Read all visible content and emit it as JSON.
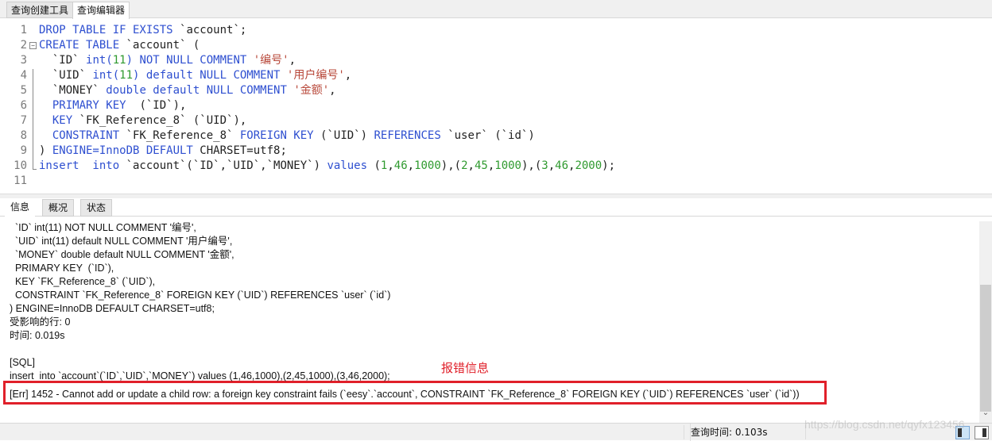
{
  "top_tabs": [
    {
      "label": "查询创建工具",
      "active": false
    },
    {
      "label": "查询编辑器",
      "active": true
    }
  ],
  "editor": {
    "lines": [
      {
        "n": "1",
        "tokens": [
          [
            "kw",
            "DROP TABLE IF EXISTS "
          ],
          [
            "pl",
            "`account`;"
          ]
        ]
      },
      {
        "n": "2",
        "fold": "−",
        "tokens": [
          [
            "kw",
            "CREATE TABLE "
          ],
          [
            "pl",
            "`account` ("
          ]
        ]
      },
      {
        "n": "3",
        "tokens": [
          [
            "pl",
            "  `ID` "
          ],
          [
            "kw",
            "int("
          ],
          [
            "num",
            "11"
          ],
          [
            "kw",
            ") NOT NULL COMMENT "
          ],
          [
            "str",
            "'编号'"
          ],
          [
            "pl",
            ","
          ]
        ]
      },
      {
        "n": "4",
        "tokens": [
          [
            "pl",
            "  `UID` "
          ],
          [
            "kw",
            "int("
          ],
          [
            "num",
            "11"
          ],
          [
            "kw",
            ") default NULL COMMENT "
          ],
          [
            "str",
            "'用户编号'"
          ],
          [
            "pl",
            ","
          ]
        ]
      },
      {
        "n": "5",
        "tokens": [
          [
            "pl",
            "  `MONEY` "
          ],
          [
            "kw",
            "double default NULL COMMENT "
          ],
          [
            "str",
            "'金额'"
          ],
          [
            "pl",
            ","
          ]
        ]
      },
      {
        "n": "6",
        "tokens": [
          [
            "kw",
            "  PRIMARY KEY  "
          ],
          [
            "pl",
            "(`ID`),"
          ]
        ]
      },
      {
        "n": "7",
        "tokens": [
          [
            "kw",
            "  KEY "
          ],
          [
            "pl",
            "`FK_Reference_8` (`UID`),"
          ]
        ]
      },
      {
        "n": "8",
        "tokens": [
          [
            "kw",
            "  CONSTRAINT "
          ],
          [
            "pl",
            "`FK_Reference_8` "
          ],
          [
            "kw",
            "FOREIGN KEY "
          ],
          [
            "pl",
            "(`UID`) "
          ],
          [
            "kw",
            "REFERENCES "
          ],
          [
            "pl",
            "`user` (`id`)"
          ]
        ]
      },
      {
        "n": "9",
        "tokens": [
          [
            "pl",
            ") "
          ],
          [
            "kw",
            "ENGINE=InnoDB DEFAULT "
          ],
          [
            "pl",
            "CHARSET=utf8;"
          ]
        ]
      },
      {
        "n": "10",
        "tokens": [
          [
            "kw",
            "insert  into "
          ],
          [
            "pl",
            "`account`(`ID`,`UID`,`MONEY`) "
          ],
          [
            "kw",
            "values "
          ],
          [
            "pl",
            "("
          ],
          [
            "num",
            "1"
          ],
          [
            "pl",
            ","
          ],
          [
            "num",
            "46"
          ],
          [
            "pl",
            ","
          ],
          [
            "num",
            "1000"
          ],
          [
            "pl",
            "),("
          ],
          [
            "num",
            "2"
          ],
          [
            "pl",
            ","
          ],
          [
            "num",
            "45"
          ],
          [
            "pl",
            ","
          ],
          [
            "num",
            "1000"
          ],
          [
            "pl",
            "),("
          ],
          [
            "num",
            "3"
          ],
          [
            "pl",
            ","
          ],
          [
            "num",
            "46"
          ],
          [
            "pl",
            ","
          ],
          [
            "num",
            "2000"
          ],
          [
            "pl",
            ");"
          ]
        ]
      },
      {
        "n": "11",
        "tokens": []
      }
    ]
  },
  "bottom_tabs": [
    {
      "label": "信息",
      "active": true
    },
    {
      "label": "概况",
      "active": false
    },
    {
      "label": "状态",
      "active": false
    }
  ],
  "messages": [
    "  `ID` int(11) NOT NULL COMMENT '编号',",
    "  `UID` int(11) default NULL COMMENT '用户编号',",
    "  `MONEY` double default NULL COMMENT '金额',",
    "  PRIMARY KEY  (`ID`),",
    "  KEY `FK_Reference_8` (`UID`),",
    "  CONSTRAINT `FK_Reference_8` FOREIGN KEY (`UID`) REFERENCES `user` (`id`)",
    ") ENGINE=InnoDB DEFAULT CHARSET=utf8;",
    "受影响的行: 0",
    "时间: 0.019s",
    "",
    "[SQL]",
    "insert  into `account`(`ID`,`UID`,`MONEY`) values (1,46,1000),(2,45,1000),(3,46,2000);",
    "[Err] 1452 - Cannot add or update a child row: a foreign key constraint fails (`eesy`.`account`, CONSTRAINT `FK_Reference_8` FOREIGN KEY (`UID`) REFERENCES `user` (`id`))"
  ],
  "annotation": "报错信息",
  "annotation_color": "#e0202a",
  "status": {
    "query_time": "查询时间: 0.103s"
  },
  "watermark": "https://blog.csdn.net/qyfx123456"
}
